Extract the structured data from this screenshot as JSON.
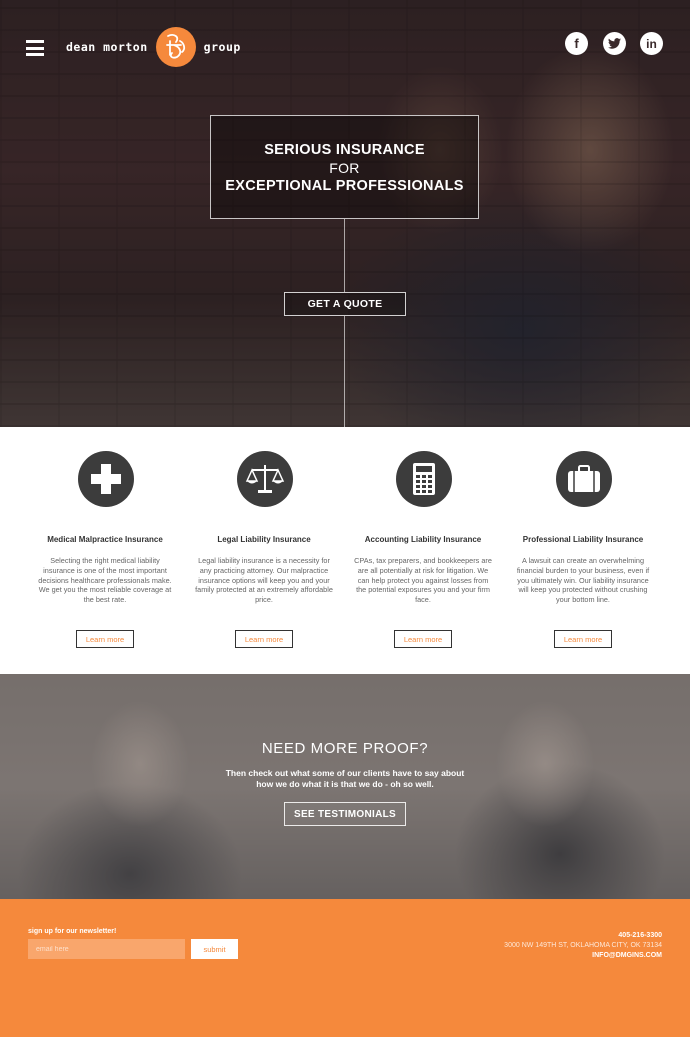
{
  "header": {
    "logo_left": "dean morton",
    "logo_right": "group",
    "social": [
      {
        "name": "facebook-icon",
        "glyph": "f"
      },
      {
        "name": "twitter-icon",
        "glyph": "t"
      },
      {
        "name": "linkedin-icon",
        "glyph": "in"
      }
    ]
  },
  "hero": {
    "line1": "SERIOUS INSURANCE",
    "line2": "FOR",
    "line3": "EXCEPTIONAL PROFESSIONALS",
    "cta": "GET A QUOTE"
  },
  "services": [
    {
      "icon": "medical-cross-icon",
      "title": "Medical Malpractice Insurance",
      "desc": "Selecting the right medical liability insurance is one of the most important decisions healthcare professionals make. We get you the most reliable coverage at the best rate.",
      "link": "Learn more"
    },
    {
      "icon": "scales-icon",
      "title": "Legal Liability Insurance",
      "desc": "Legal liability insurance is a necessity for any practicing attorney. Our malpractice insurance options will keep you and your family protected at an extremely affordable price.",
      "link": "Learn more"
    },
    {
      "icon": "calculator-icon",
      "title": "Accounting Liability Insurance",
      "desc": "CPAs, tax preparers, and bookkeepers are are all potentially at risk for litigation. We can help protect you against losses from the potential exposures you and your firm face.",
      "link": "Learn more"
    },
    {
      "icon": "briefcase-icon",
      "title": "Professional Liability Insurance",
      "desc": "A lawsuit can create an overwhelming financial burden to your business, even if you ultimately win. Our liability insurance will keep you protected without crushing your bottom line.",
      "link": "Learn more"
    }
  ],
  "proof": {
    "heading": "NEED MORE PROOF?",
    "text": "Then check out what some of our clients have to say about how we do what it is that we do - oh so well.",
    "button": "SEE TESTIMONIALS"
  },
  "footer": {
    "newsletter_label": "sign up for our newsletter!",
    "email_placeholder": "email here",
    "submit_label": "submit",
    "phone": "405-216-3300",
    "address": "3000 NW 149TH ST, OKLAHOMA CITY, OK 73134",
    "email": "INFO@DMGINS.COM"
  },
  "colors": {
    "accent": "#f5893c",
    "icon_bg": "#3c3c3c"
  }
}
